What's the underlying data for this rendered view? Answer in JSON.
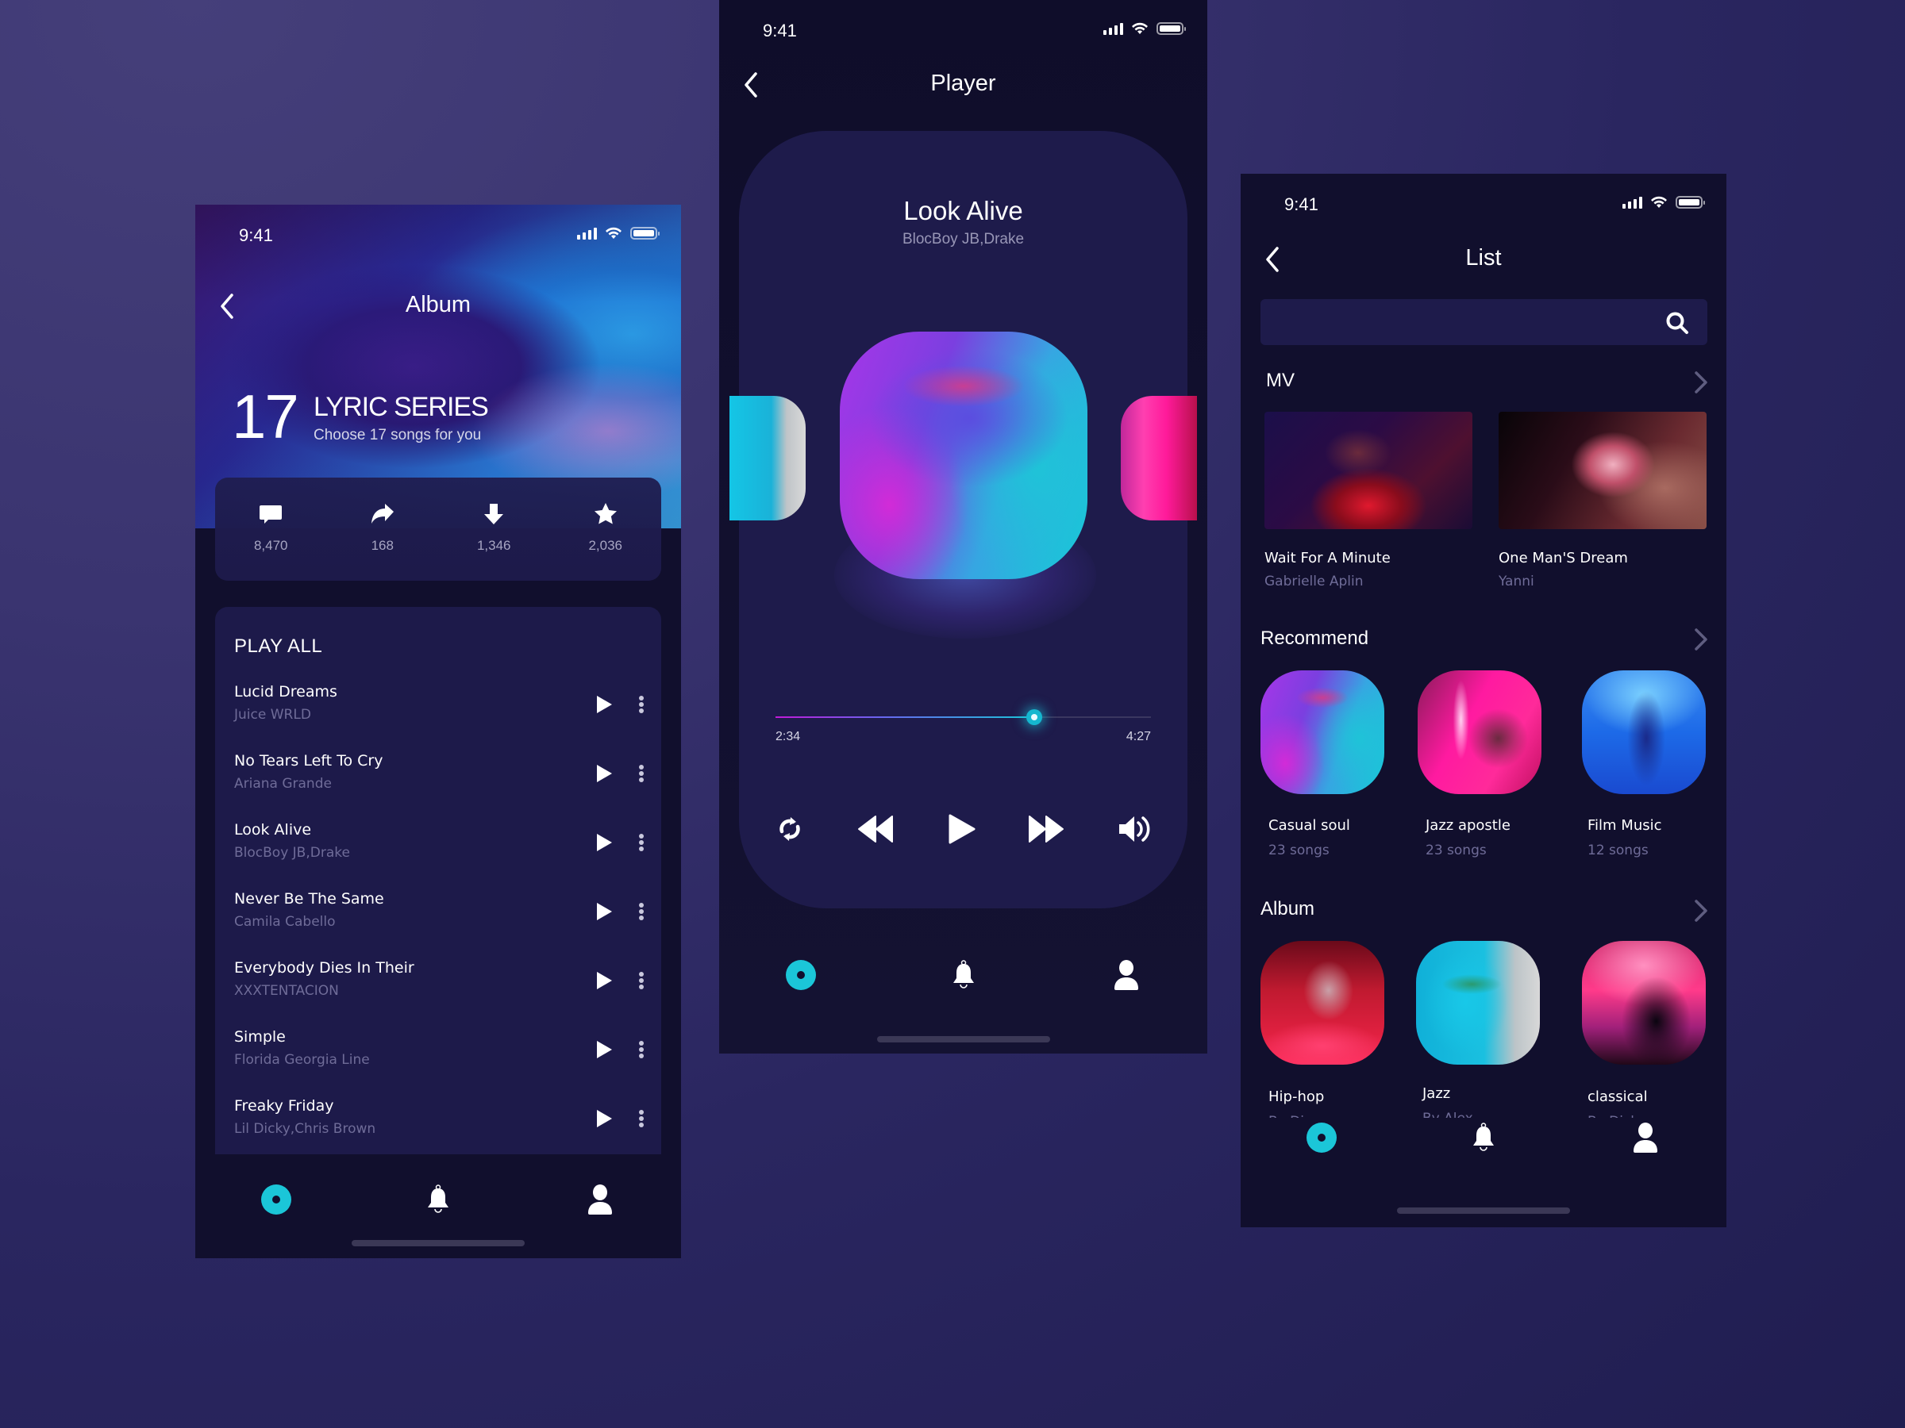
{
  "colors": {
    "accent": "#1bc6d8",
    "panel": "#1e1b4b",
    "screen_bg": "#110f2d",
    "muted_text": "#6f6c98"
  },
  "status_bar": {
    "time": "9:41"
  },
  "album_screen": {
    "nav_title": "Album",
    "hero": {
      "number": "17",
      "title": "LYRIC SERIES",
      "subtitle": "Choose 17 songs for you"
    },
    "stats": [
      {
        "icon": "comment-icon",
        "value": "8,470"
      },
      {
        "icon": "share-icon",
        "value": "168"
      },
      {
        "icon": "download-icon",
        "value": "1,346"
      },
      {
        "icon": "star-icon",
        "value": "2,036"
      }
    ],
    "play_all_label": "PLAY ALL",
    "songs": [
      {
        "title": "Lucid Dreams",
        "artist": "Juice WRLD"
      },
      {
        "title": "No Tears Left To Cry",
        "artist": "Ariana Grande"
      },
      {
        "title": "Look Alive",
        "artist": "BlocBoy JB,Drake"
      },
      {
        "title": "Never Be The Same",
        "artist": "Camila Cabello"
      },
      {
        "title": "Everybody Dies In Their",
        "artist": "XXXTENTACION"
      },
      {
        "title": "Simple",
        "artist": "Florida Georgia Line"
      },
      {
        "title": "Freaky Friday",
        "artist": "Lil Dicky,Chris Brown"
      }
    ]
  },
  "player_screen": {
    "nav_title": "Player",
    "now_playing": {
      "title": "Look Alive",
      "artist": "BlocBoy JB,Drake"
    },
    "current_time": "2:34",
    "total_time": "4:27",
    "progress_fraction": 0.69,
    "controls": [
      "repeat-icon",
      "rewind-icon",
      "play-icon",
      "fast-forward-icon",
      "volume-icon"
    ]
  },
  "list_screen": {
    "nav_title": "List",
    "search": {
      "value": "",
      "placeholder": ""
    },
    "mv_section": {
      "title": "MV",
      "items": [
        {
          "title": "Wait For A Minute",
          "artist": "Gabrielle Aplin"
        },
        {
          "title": "One Man'S Dream",
          "artist": "Yanni"
        }
      ]
    },
    "recommend_section": {
      "title": "Recommend",
      "items": [
        {
          "title": "Casual soul",
          "count": "23 songs"
        },
        {
          "title": "Jazz apostle",
          "count": "23 songs"
        },
        {
          "title": "Film Music",
          "count": "12 songs"
        }
      ]
    },
    "album_section": {
      "title": "Album",
      "items": [
        {
          "title": "Hip-hop",
          "subtitle": "By Dinga"
        },
        {
          "title": "Jazz",
          "subtitle": "By Alex"
        },
        {
          "title": "classical",
          "subtitle": "By Dick"
        }
      ]
    }
  },
  "tab_bar": {
    "tabs": [
      {
        "icon": "music-disc-icon",
        "active": true
      },
      {
        "icon": "bell-icon",
        "active": false
      },
      {
        "icon": "profile-icon",
        "active": false
      }
    ]
  }
}
